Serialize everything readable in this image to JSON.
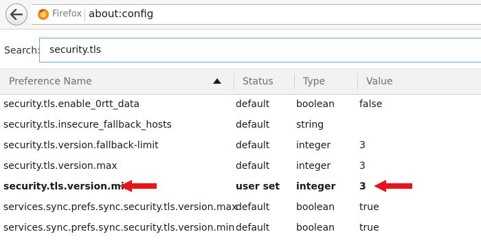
{
  "browser": {
    "brand_label": "Firefox",
    "url": "about:config"
  },
  "search": {
    "label": "Search:",
    "value": "security.tls"
  },
  "table": {
    "columns": [
      "Preference Name",
      "Status",
      "Type",
      "Value"
    ],
    "sort": {
      "column": "Preference Name",
      "direction": "ascending"
    },
    "rows": [
      {
        "name": "security.tls.enable_0rtt_data",
        "status": "default",
        "type": "boolean",
        "value": "false",
        "modified": false
      },
      {
        "name": "security.tls.insecure_fallback_hosts",
        "status": "default",
        "type": "string",
        "value": "",
        "modified": false
      },
      {
        "name": "security.tls.version.fallback-limit",
        "status": "default",
        "type": "integer",
        "value": "3",
        "modified": false
      },
      {
        "name": "security.tls.version.max",
        "status": "default",
        "type": "integer",
        "value": "3",
        "modified": false
      },
      {
        "name": "security.tls.version.min",
        "status": "user set",
        "type": "integer",
        "value": "3",
        "modified": true
      },
      {
        "name": "services.sync.prefs.sync.security.tls.version.max",
        "status": "default",
        "type": "boolean",
        "value": "true",
        "modified": false
      },
      {
        "name": "services.sync.prefs.sync.security.tls.version.min",
        "status": "default",
        "type": "boolean",
        "value": "true",
        "modified": false
      }
    ]
  },
  "annotations": {
    "arrow_color": "#e8141b",
    "arrows": [
      {
        "points_to": "preference name of row 5",
        "direction": "left"
      },
      {
        "points_to": "value of row 5",
        "direction": "left"
      }
    ]
  },
  "colors": {
    "focus_border": "#6aa4dc",
    "header_text": "#6f6f6f",
    "firefox_orange": "#f08a24"
  }
}
